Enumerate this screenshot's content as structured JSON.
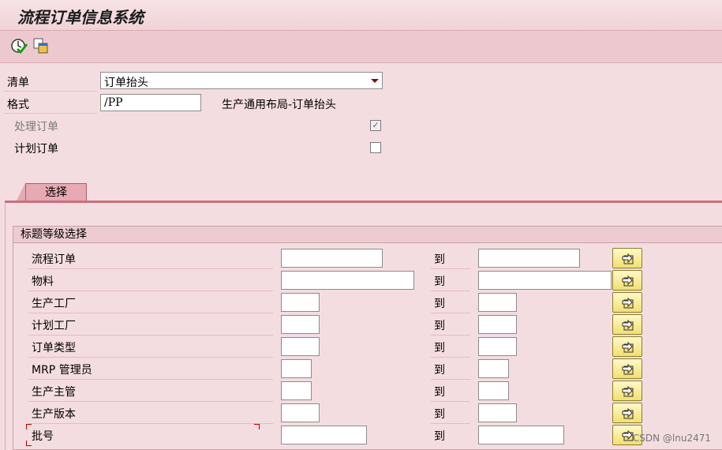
{
  "window": {
    "title": "流程订单信息系统"
  },
  "toolbar": {
    "items": [
      {
        "icon": "execute-clock-check-icon"
      },
      {
        "icon": "copy-variant-icon"
      }
    ]
  },
  "header": {
    "list_label": "清单",
    "list_value": "订单抬头",
    "format_label": "格式",
    "format_value": "/PP",
    "format_desc": "生产通用布局-订单抬头",
    "process_orders_label": "处理订单",
    "process_orders_checked": true,
    "planned_orders_label": "计划订单",
    "planned_orders_checked": false
  },
  "tabs": [
    {
      "label": "选择",
      "active": true
    }
  ],
  "selection_group": {
    "title": "标题等级选择",
    "to_label": "到",
    "rows": [
      {
        "label": "流程订单",
        "from": "",
        "to": ""
      },
      {
        "label": "物料",
        "from": "",
        "to": ""
      },
      {
        "label": "生产工厂",
        "from": "",
        "to": ""
      },
      {
        "label": "计划工厂",
        "from": "",
        "to": ""
      },
      {
        "label": "订单类型",
        "from": "",
        "to": ""
      },
      {
        "label": "MRP 管理员",
        "from": "",
        "to": ""
      },
      {
        "label": "生产主管",
        "from": "",
        "to": ""
      },
      {
        "label": "生产版本",
        "from": "",
        "to": ""
      },
      {
        "label": "批号",
        "from": "",
        "to": ""
      }
    ],
    "multiple_selection_icon": "arrow-into-box-icon"
  },
  "watermark": "CSDN @lnu2471",
  "colors": {
    "background": "#f4dde0",
    "tab_active": "#e7a9b3",
    "button_yellow": "#f2e070"
  }
}
